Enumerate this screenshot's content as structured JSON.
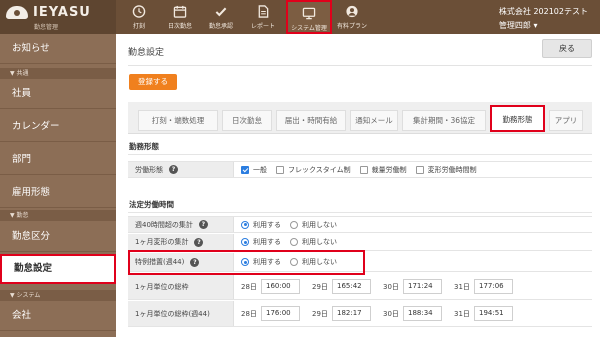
{
  "logo": {
    "name": "IEYASU",
    "sub": "勤怠管理"
  },
  "nav": [
    {
      "label": "打刻",
      "icon": "clock-icon"
    },
    {
      "label": "日次勤怠",
      "icon": "calendar-icon"
    },
    {
      "label": "勤怠承認",
      "icon": "check-icon"
    },
    {
      "label": "レポート",
      "icon": "document-icon"
    },
    {
      "label": "システム管理",
      "icon": "monitor-icon",
      "active": true
    },
    {
      "label": "有料プラン",
      "icon": "user-icon"
    }
  ],
  "company": {
    "name": "株式会社 202102テスト",
    "user": "管理四郎 ▾"
  },
  "sidebar": {
    "notice": "お知らせ",
    "section_common": "▼ 共通",
    "employees": "社員",
    "calendar": "カレンダー",
    "department": "部門",
    "employment_type": "雇用形態",
    "section_attendance": "▼ 勤怠",
    "attendance_category": "勤怠区分",
    "attendance_settings": "勤怠設定",
    "section_system": "▼ システム",
    "company": "会社"
  },
  "main": {
    "title": "勤怠設定",
    "back": "戻る",
    "register": "登録する",
    "tabs": [
      "打刻・端数処理",
      "日次勤怠",
      "届出・時間有給",
      "通知メール",
      "集計期間・36協定",
      "勤務形態",
      "アプリ"
    ],
    "active_tab": "勤務形態",
    "work_style_section": "勤務形態",
    "work_style_label": "労働形態",
    "work_style_options": [
      "一般",
      "フレックスタイム制",
      "裁量労働制",
      "変形労働時間制"
    ],
    "legal_section": "法定労働時間",
    "rows": [
      {
        "label": "週40時間超の集計",
        "on": "利用する",
        "off": "利用しない"
      },
      {
        "label": "1ヶ月変形の集計",
        "on": "利用する",
        "off": "利用しない"
      },
      {
        "label": "特例措置(週44)",
        "on": "利用する",
        "off": "利用しない"
      }
    ],
    "limit_rows": [
      {
        "label": "1ヶ月単位の総枠",
        "values": [
          {
            "day": "28日",
            "time": "160:00"
          },
          {
            "day": "29日",
            "time": "165:42"
          },
          {
            "day": "30日",
            "time": "171:24"
          },
          {
            "day": "31日",
            "time": "177:06"
          }
        ]
      },
      {
        "label": "1ヶ月単位の総枠(週44)",
        "values": [
          {
            "day": "28日",
            "time": "176:00"
          },
          {
            "day": "29日",
            "time": "182:17"
          },
          {
            "day": "30日",
            "time": "188:34"
          },
          {
            "day": "31日",
            "time": "194:51"
          }
        ]
      }
    ]
  },
  "colors": {
    "header": "#6b4f37",
    "sidebar": "#8c6e56",
    "accent": "#f0801e",
    "highlight": "#e0001b"
  }
}
